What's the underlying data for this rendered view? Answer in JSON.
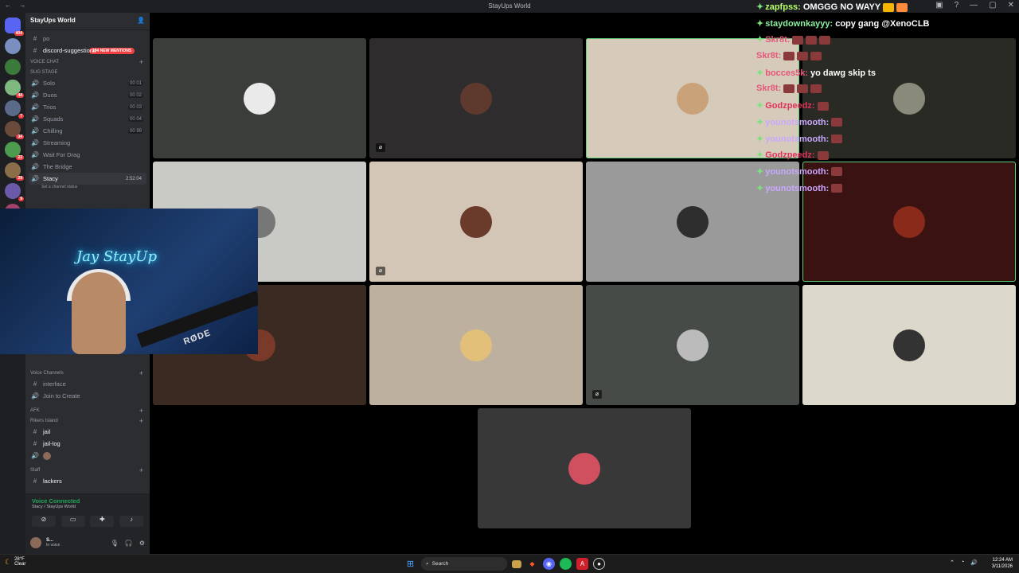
{
  "window": {
    "title": "StayUps World",
    "nav": "← →"
  },
  "servers": [
    {
      "color": "#5865f2",
      "badge": "404"
    },
    {
      "color": "#7a8fbf",
      "badge": ""
    },
    {
      "color": "#3b7a3b",
      "badge": ""
    },
    {
      "color": "#7fb87f",
      "badge": "44"
    },
    {
      "color": "#5a6b8a",
      "badge": "7"
    },
    {
      "color": "#6a4a3a",
      "badge": "34"
    },
    {
      "color": "#4e9a4e",
      "badge": "22"
    },
    {
      "color": "#8a6e4a",
      "badge": "29"
    },
    {
      "color": "#6b5aa8",
      "badge": "9"
    },
    {
      "color": "#a3436d",
      "badge": ""
    },
    {
      "color": "#4a6e8a",
      "badge": "194"
    }
  ],
  "sidebar": {
    "server_name": "StayUps World",
    "mention_badge": "194 NEW MENTIONS",
    "channel_po": "po",
    "channel_suggestions": "discord-suggestions",
    "voice_chat_label": "VOICE CHAT",
    "stage_label": "SUG STAGE",
    "voice_channels": [
      {
        "name": "Solo",
        "count": "00 01"
      },
      {
        "name": "Duos",
        "count": "00 02"
      },
      {
        "name": "Trios",
        "count": "00 03"
      },
      {
        "name": "Squads",
        "count": "00 04"
      },
      {
        "name": "Chilling",
        "count": "00 99"
      },
      {
        "name": "Streaming",
        "count": ""
      },
      {
        "name": "Wait For Drag",
        "count": ""
      },
      {
        "name": "The Bridge",
        "count": ""
      }
    ],
    "active_channel": {
      "name": "Stacy",
      "time": "2:52:04",
      "status": "Set a channel status"
    },
    "voice_channels_label": "Voice Channels",
    "interface": "interface",
    "join_to_create": "Join to Create",
    "afk": "AFK",
    "rikers": "Rikers Island",
    "jail": "jail",
    "jail_log": "jail-log",
    "staff": "Staff",
    "lackers": "lackers"
  },
  "voice_connected": {
    "status": "Voice Connected",
    "location": "Stacy / StayUps World"
  },
  "user": {
    "name": "S...",
    "status": "In voice"
  },
  "tiles": [
    {
      "bg": "#3a3d3a",
      "avatar": "#eaeaea",
      "muted": false
    },
    {
      "bg": "#2e2c2c",
      "avatar": "#5e3a2e",
      "muted": true
    },
    {
      "bg": "#d6cbbb",
      "avatar": "#c9a27a",
      "muted": false,
      "speaking": true
    },
    {
      "bg": "#2a2a24",
      "avatar": "#8a8a7a",
      "muted": false
    },
    {
      "bg": "#c9c9c6",
      "avatar": "#777",
      "muted": false
    },
    {
      "bg": "#d4c6b6",
      "avatar": "#6a3a2a",
      "muted": true
    },
    {
      "bg": "#9a9a9a",
      "avatar": "#2e2e2e",
      "muted": false
    },
    {
      "bg": "#3a1212",
      "avatar": "#8a2a1a",
      "muted": false,
      "speaking": true
    },
    {
      "bg": "#3b2a22",
      "avatar": "#7a3a2a",
      "muted": false
    },
    {
      "bg": "#bdb09e",
      "avatar": "#e2c07a",
      "muted": false
    },
    {
      "bg": "#464b47",
      "avatar": "#bbbbbb",
      "muted": true
    },
    {
      "bg": "#ddd8cc",
      "avatar": "#333",
      "muted": false
    },
    {
      "bg": "#383838",
      "avatar": "#d05060",
      "muted": false
    }
  ],
  "webcam": {
    "neon_text": "Jay StayUp",
    "mic_brand": "RØDE"
  },
  "chat": [
    {
      "user": "zapfpss:",
      "color": "#b6ff6a",
      "text": "OMGGG NO WAYY",
      "emotes": [
        "#f4b400",
        "#ff8a3a"
      ],
      "badge": "✦"
    },
    {
      "user": "staydownkayyy:",
      "color": "#8df0a0",
      "text": "copy gang @XenoCLB",
      "emotes": [],
      "badge": "✦"
    },
    {
      "user": "Skr8t:",
      "color": "#e6567a",
      "text": "",
      "emotes": [
        "#8a3a3a",
        "#8a3a3a",
        "#8a3a3a"
      ],
      "badge": "✦"
    },
    {
      "user": "Skr8t:",
      "color": "#e6567a",
      "text": "",
      "emotes": [
        "#8a3a3a",
        "#8a3a3a",
        "#8a3a3a"
      ],
      "badge": ""
    },
    {
      "user": "bocces5k:",
      "color": "#e6567a",
      "text": "yo dawg skip ts",
      "emotes": [],
      "badge": "✦"
    },
    {
      "user": "Skr8t:",
      "color": "#e6567a",
      "text": "",
      "emotes": [
        "#8a3a3a",
        "#8a3a3a",
        "#8a3a3a"
      ],
      "badge": ""
    },
    {
      "user": "Godzpeedz:",
      "color": "#e0305a",
      "text": "",
      "emotes": [
        "#8a3a3a"
      ],
      "badge": "✦"
    },
    {
      "user": "younotsmooth:",
      "color": "#c9a8ff",
      "text": "",
      "emotes": [
        "#8a3a3a"
      ],
      "badge": "✦"
    },
    {
      "user": "younotsmooth:",
      "color": "#c9a8ff",
      "text": "",
      "emotes": [
        "#8a3a3a"
      ],
      "badge": "✦"
    },
    {
      "user": "Godzpeedz:",
      "color": "#e0305a",
      "text": "",
      "emotes": [
        "#8a3a3a"
      ],
      "badge": "✦"
    },
    {
      "user": "younotsmooth:",
      "color": "#c9a8ff",
      "text": "",
      "emotes": [
        "#8a3a3a"
      ],
      "badge": "✦"
    },
    {
      "user": "younotsmooth:",
      "color": "#c9a8ff",
      "text": "",
      "emotes": [
        "#8a3a3a"
      ],
      "badge": "✦"
    }
  ],
  "taskbar": {
    "temp": "28°F",
    "weather": "Clear",
    "search": "Search",
    "time": "12:24 AM",
    "date": "3/11/2026"
  }
}
